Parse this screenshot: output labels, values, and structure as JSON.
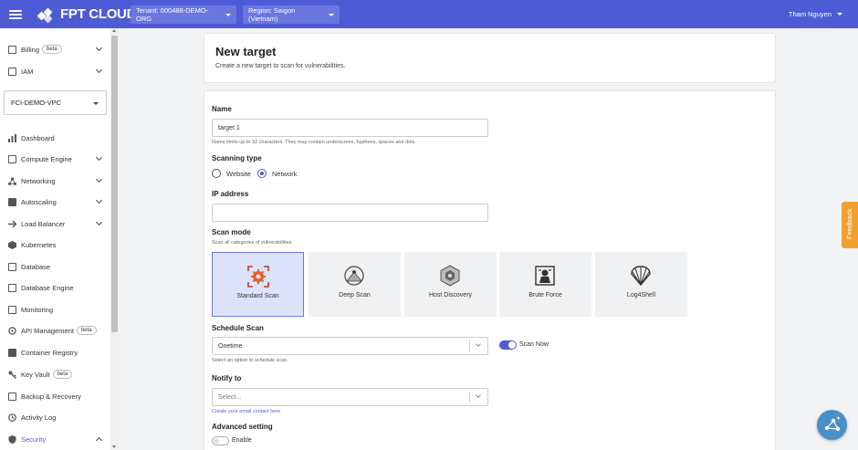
{
  "topbar": {
    "brand": "FPT CLOUD",
    "tenant": "Tenant: 000488-DEMO-ORG",
    "region": "Region: Saigon (Vietnam)",
    "user": "Tham Nguyen"
  },
  "sidebar": {
    "billing": "Billing",
    "beta": "beta",
    "iam": "IAM",
    "vpc": "FCI-DEMO-VPC",
    "items": [
      {
        "label": "Dashboard"
      },
      {
        "label": "Compute Engine"
      },
      {
        "label": "Networking"
      },
      {
        "label": "Autoscaling"
      },
      {
        "label": "Load Balancer"
      },
      {
        "label": "Kubernetes"
      },
      {
        "label": "Database"
      },
      {
        "label": "Database Engine"
      },
      {
        "label": "Monitoring"
      },
      {
        "label": "API Management"
      },
      {
        "label": "Container Registry"
      },
      {
        "label": "Key Vault"
      },
      {
        "label": "Backup & Recovery"
      },
      {
        "label": "Activity Log"
      },
      {
        "label": "Security"
      }
    ]
  },
  "header": {
    "title": "New target",
    "subtitle": "Create a new target to scan for vulnerabilities."
  },
  "form": {
    "name_label": "Name",
    "name_value": "target 1",
    "name_hint": "Name limits up to 32 characters. They may contain underscores, hyphens, spaces and dots.",
    "scan_type_label": "Scanning type",
    "scan_type_website": "Website",
    "scan_type_network": "Network",
    "ip_label": "IP address",
    "ip_value": "",
    "mode_label": "Scan mode",
    "mode_hint": "Scan all categories of vulnerabilities.",
    "modes": [
      {
        "label": "Standard Scan"
      },
      {
        "label": "Deep Scan"
      },
      {
        "label": "Host Discovery"
      },
      {
        "label": "Brute Force"
      },
      {
        "label": "Log4Shell"
      }
    ],
    "schedule_label": "Schedule Scan",
    "schedule_value": "Onetime",
    "schedule_hint": "Select an option to schedule scan.",
    "scan_now": "Scan Now",
    "notify_label": "Notify to",
    "notify_placeholder": "Select...",
    "notify_link": "Create your email contact here",
    "advanced_label": "Advanced setting",
    "advanced_toggle": "Enable"
  },
  "feedback": "Feedback",
  "colors": {
    "accent": "#4f5bd5",
    "feedback": "#f0a030",
    "fab": "#4a90c8"
  }
}
